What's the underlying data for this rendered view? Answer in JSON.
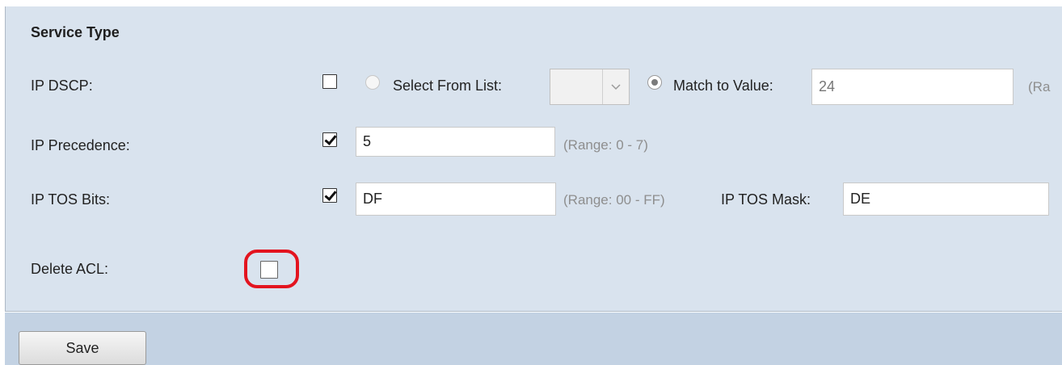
{
  "section": {
    "title": "Service Type"
  },
  "ip_dscp": {
    "label": "IP DSCP:",
    "select_label": "Select From List:",
    "match_label": "Match to Value:",
    "match_value": "24",
    "range_hint": "(Ra"
  },
  "ip_precedence": {
    "label": "IP Precedence:",
    "value": "5",
    "range_hint": "(Range: 0 - 7)"
  },
  "ip_tos_bits": {
    "label": "IP TOS Bits:",
    "value": "DF",
    "range_hint": "(Range: 00 - FF)",
    "mask_label": "IP TOS Mask:",
    "mask_value": "DE"
  },
  "delete_acl": {
    "label": "Delete ACL:"
  },
  "actions": {
    "save_label": "Save"
  },
  "colors": {
    "highlight": "#e3141f",
    "panel": "#d9e3ee",
    "strip": "#c3d2e3"
  },
  "icons": {
    "select_arrow": "chevron-down-icon"
  }
}
